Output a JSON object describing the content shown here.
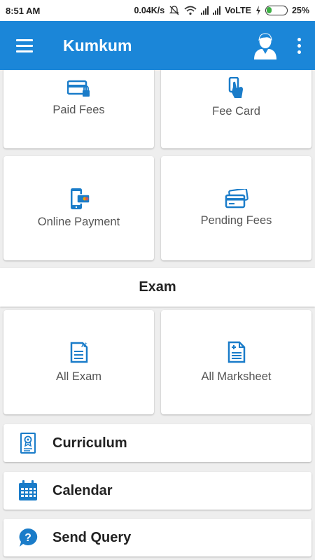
{
  "status": {
    "time": "8:51 AM",
    "speed": "0.04K/s",
    "network": "VoLTE",
    "battery": "25%"
  },
  "appbar": {
    "title": "Kumkum",
    "menu_icon": "hamburger-menu-icon",
    "profile_icon": "user-profile-icon",
    "more_icon": "overflow-menu-icon"
  },
  "fees": {
    "tiles": [
      {
        "label": "Paid Fees",
        "icon": "card-lock-icon"
      },
      {
        "label": "Fee Card",
        "icon": "hand-card-icon"
      },
      {
        "label": "Online Payment",
        "icon": "mobile-payment-icon"
      },
      {
        "label": "Pending Fees",
        "icon": "cards-icon"
      }
    ]
  },
  "exam": {
    "header": "Exam",
    "tiles": [
      {
        "label": "All Exam",
        "icon": "exam-document-icon"
      },
      {
        "label": "All Marksheet",
        "icon": "marksheet-icon"
      }
    ]
  },
  "menu_rows": [
    {
      "label": "Curriculum",
      "icon": "curriculum-certificate-icon"
    },
    {
      "label": "Calendar",
      "icon": "calendar-icon"
    },
    {
      "label": "Send Query",
      "icon": "query-chat-icon"
    }
  ],
  "colors": {
    "primary": "#1b86d8",
    "icon_blue": "#1a7cc9",
    "background": "#eeeeee"
  }
}
